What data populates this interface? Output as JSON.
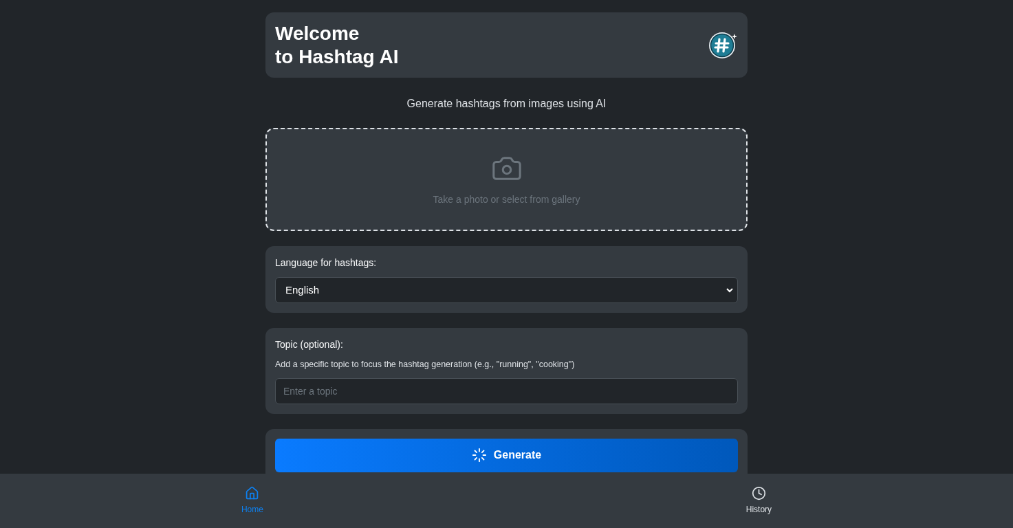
{
  "header": {
    "title_lines": [
      "Welcome",
      "to Hashtag AI"
    ]
  },
  "subtitle": "Generate hashtags from images using AI",
  "upload": {
    "hint": "Take a photo or select from gallery"
  },
  "language": {
    "label": "Language for hashtags:",
    "value": "English"
  },
  "topic": {
    "label": "Topic (optional):",
    "help": "Add a specific topic to focus the hashtag generation (e.g., \"running\", \"cooking\")",
    "placeholder": "Enter a topic"
  },
  "generate_button": {
    "label": "Generate"
  },
  "nav": [
    {
      "kind": "home",
      "label": "Home",
      "selected": true
    },
    {
      "kind": "history",
      "label": "History",
      "selected": false
    }
  ]
}
